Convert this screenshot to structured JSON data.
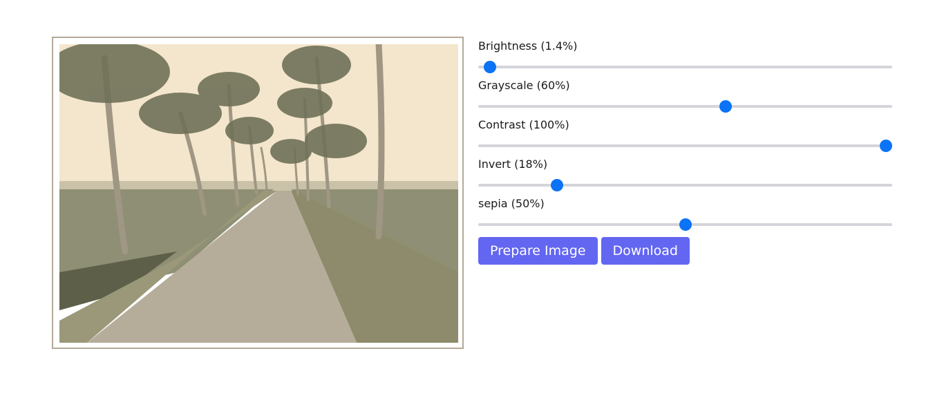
{
  "image": {
    "palette": {
      "sky": "#f4e6cc",
      "distant": "#c9c2a8",
      "field": "#8e8f74",
      "field_dark": "#5d5f48",
      "road": "#b5ad9a",
      "grass": "#8d8b6c",
      "trunk": "#a79f88",
      "frond": "#6f7158"
    }
  },
  "sliders": [
    {
      "label": "Brightness (1.4%)",
      "value": 0.014
    },
    {
      "label": "Grayscale (60%)",
      "value": 0.6
    },
    {
      "label": "Contrast (100%)",
      "value": 1.0
    },
    {
      "label": "Invert (18%)",
      "value": 0.18
    },
    {
      "label": "sepia (50%)",
      "value": 0.5
    }
  ],
  "buttons": {
    "prepare_label": "Prepare Image",
    "download_label": "Download"
  },
  "colors": {
    "accent": "#6366f1",
    "slider_thumb": "#0b73f5",
    "slider_track": "#d3d5da"
  }
}
